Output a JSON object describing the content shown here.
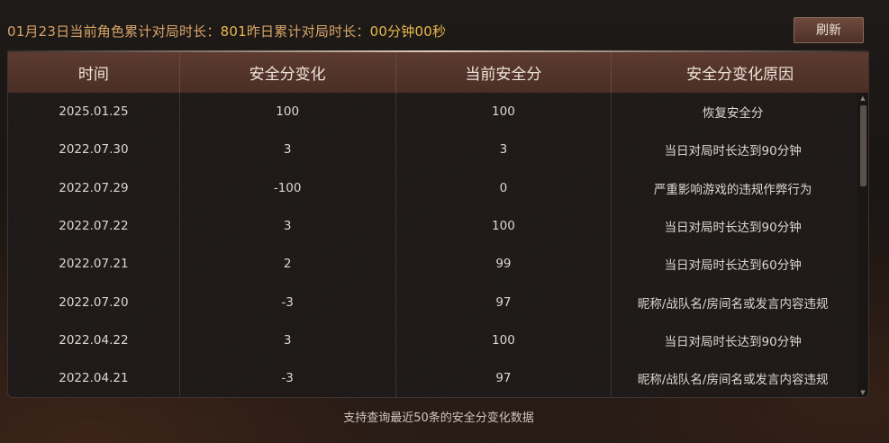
{
  "header": {
    "date_text": "01月23日",
    "current_label": "当前角色累计对局时长：",
    "current_value": "801",
    "yesterday_label": "昨日累计对局时长：",
    "yesterday_value": "00分钟00秒",
    "refresh_label": "刷新"
  },
  "table": {
    "columns": [
      "时间",
      "安全分变化",
      "当前安全分",
      "安全分变化原因"
    ],
    "rows": [
      {
        "time": "2025.01.25",
        "change": "100",
        "current": "100",
        "reason": "恢复安全分"
      },
      {
        "time": "2022.07.30",
        "change": "3",
        "current": "3",
        "reason": "当日对局时长达到90分钟"
      },
      {
        "time": "2022.07.29",
        "change": "-100",
        "current": "0",
        "reason": "严重影响游戏的违规作弊行为"
      },
      {
        "time": "2022.07.22",
        "change": "3",
        "current": "100",
        "reason": "当日对局时长达到90分钟"
      },
      {
        "time": "2022.07.21",
        "change": "2",
        "current": "99",
        "reason": "当日对局时长达到60分钟"
      },
      {
        "time": "2022.07.20",
        "change": "-3",
        "current": "97",
        "reason": "昵称/战队名/房间名或发言内容违规"
      },
      {
        "time": "2022.04.22",
        "change": "3",
        "current": "100",
        "reason": "当日对局时长达到90分钟"
      },
      {
        "time": "2022.04.21",
        "change": "-3",
        "current": "97",
        "reason": "昵称/战队名/房间名或发言内容违规"
      }
    ]
  },
  "footer": {
    "note": "支持查询最近50条的安全分变化数据"
  },
  "icons": {
    "scroll_up": "triangle-up-icon",
    "scroll_down": "triangle-down-icon"
  }
}
